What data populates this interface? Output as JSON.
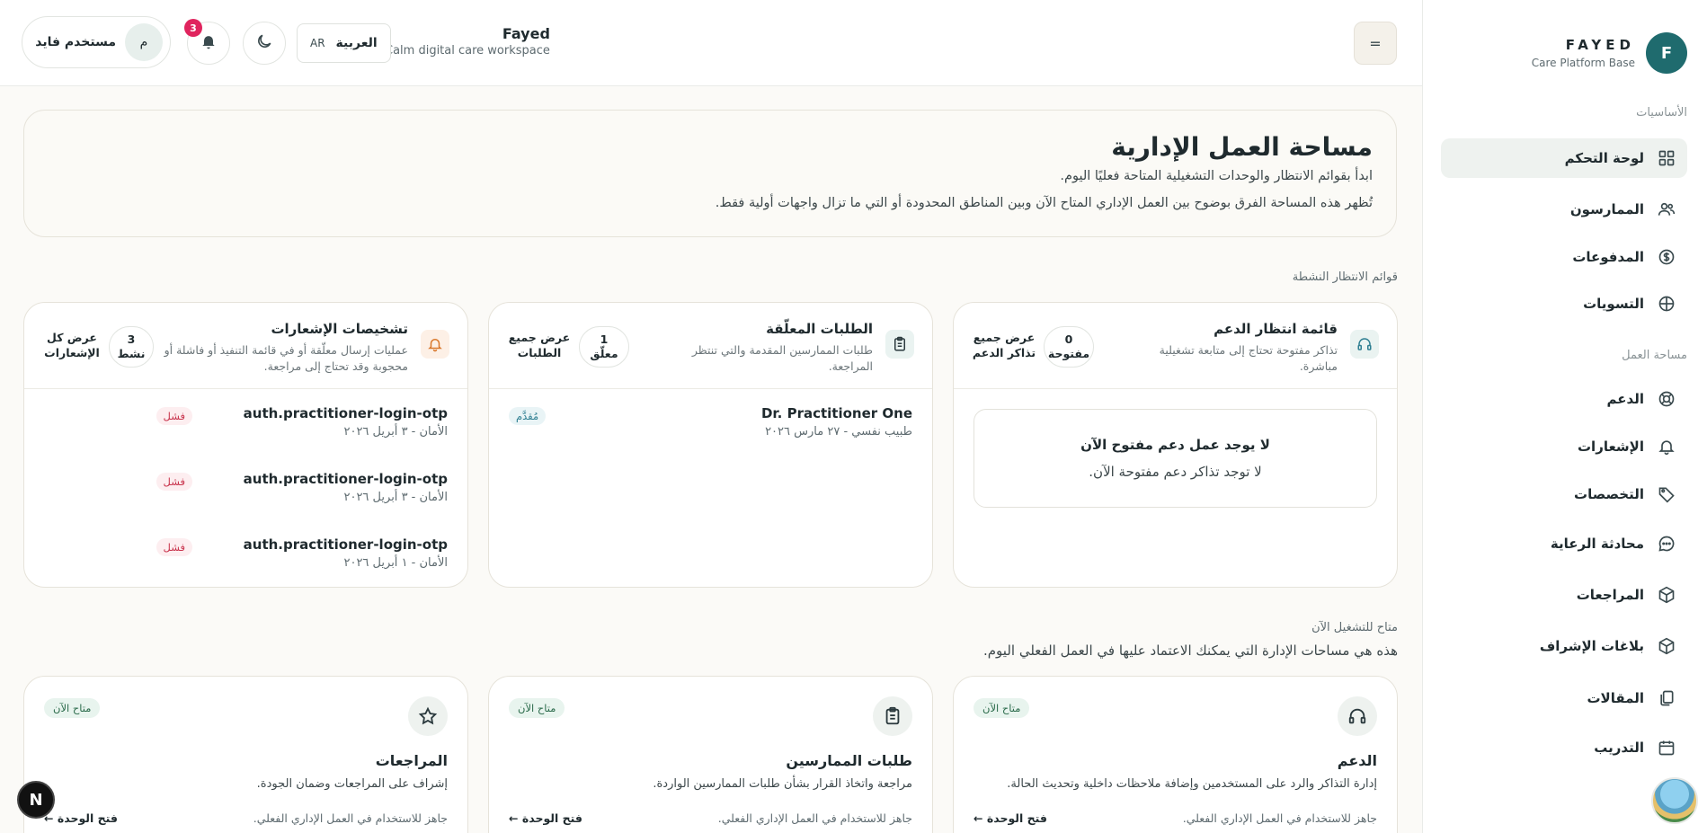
{
  "brand": {
    "name": "FAYED",
    "subtitle": "Care Platform Base",
    "initial": "F"
  },
  "sidebar": {
    "section_basics": "الأساسيات",
    "section_workspace": "مساحة العمل",
    "items": [
      {
        "label": "لوحة التحكم",
        "icon": "grid-icon",
        "active": true
      },
      {
        "label": "الممارسون",
        "icon": "users-icon"
      },
      {
        "label": "المدفوعات",
        "icon": "dollar-icon"
      },
      {
        "label": "التسويات",
        "icon": "globe-icon"
      },
      {
        "label": "الدعم",
        "icon": "lifebuoy-icon"
      },
      {
        "label": "الإشعارات",
        "icon": "bell-icon"
      },
      {
        "label": "التخصصات",
        "icon": "tag-icon"
      },
      {
        "label": "محادثة الرعاية",
        "icon": "chat-icon"
      },
      {
        "label": "المراجعات",
        "icon": "box-icon"
      },
      {
        "label": "بلاغات الإشراف",
        "icon": "box-icon"
      },
      {
        "label": "المقالات",
        "icon": "copy-icon"
      },
      {
        "label": "التدريب",
        "icon": "calendar-icon"
      }
    ]
  },
  "header": {
    "menu_label": "=",
    "workspace_name": "Fayed",
    "workspace_tagline": "Calm digital care workspace",
    "lang_code": "AR",
    "lang_name": "العربية",
    "notif_count": "3",
    "user_initial": "م",
    "user_name": "مستخدم فايد"
  },
  "hero": {
    "title": "مساحة العمل الإدارية",
    "line1": "ابدأ بقوائم الانتظار والوحدات التشغيلية المتاحة فعليًا اليوم.",
    "line2": "تُظهر هذه المساحة الفرق بوضوح بين العمل الإداري المتاح الآن وبين المناطق المحدودة أو التي ما تزال واجهات أولية فقط."
  },
  "queues_label": "قوائم الانتظار النشطة",
  "queues": {
    "support": {
      "title": "قائمة انتظار الدعم",
      "desc": "تذاكر مفتوحة تحتاج إلى متابعة تشغيلية مباشرة.",
      "count": "0",
      "count_label": "مفتوحة",
      "link": "عرض جميع تذاكر الدعم",
      "empty_title": "لا يوجد عمل دعم مفتوح الآن",
      "empty_desc": "لا توجد تذاكر دعم مفتوحة الآن."
    },
    "requests": {
      "title": "الطلبات المعلّقة",
      "desc": "طلبات الممارسين المقدمة والتي تنتظر المراجعة.",
      "count": "1",
      "count_label": "معلّق",
      "link": "عرض جميع الطلبات",
      "rows": [
        {
          "title": "Dr. Practitioner One",
          "sub": "طبيب نفسي - ٢٧ مارس ٢٠٢٦",
          "status": "مُقدَّم"
        }
      ]
    },
    "notifications": {
      "title": "تشخيصات الإشعارات",
      "desc": "عمليات إرسال معلّقة أو في قائمة التنفيذ أو فاشلة أو محجوبة وقد تحتاج إلى مراجعة.",
      "count": "3",
      "count_label": "نشط",
      "link": "عرض كل الإشعارات",
      "rows": [
        {
          "title": "auth.practitioner-login-otp",
          "sub": "الأمان - ٣ أبريل ٢٠٢٦",
          "status": "فشل"
        },
        {
          "title": "auth.practitioner-login-otp",
          "sub": "الأمان - ٣ أبريل ٢٠٢٦",
          "status": "فشل"
        },
        {
          "title": "auth.practitioner-login-otp",
          "sub": "الأمان - ١ أبريل ٢٠٢٦",
          "status": "فشل"
        }
      ]
    }
  },
  "available": {
    "label": "متاح للتشغيل الآن",
    "desc": "هذه هي مساحات الإدارة التي يمكنك الاعتماد عليها في العمل الفعلي اليوم.",
    "cards": [
      {
        "title": "الدعم",
        "desc": "إدارة التذاكر والرد على المستخدمين وإضافة ملاحظات داخلية وتحديث الحالة.",
        "status": "متاح الآن",
        "footer": "جاهز للاستخدام في العمل الإداري الفعلي.",
        "link": "فتح الوحدة",
        "icon": "headset-icon"
      },
      {
        "title": "طلبات الممارسين",
        "desc": "مراجعة واتخاذ القرار بشأن طلبات الممارسين الواردة.",
        "status": "متاح الآن",
        "footer": "جاهز للاستخدام في العمل الإداري الفعلي.",
        "link": "فتح الوحدة",
        "icon": "clipboard-icon"
      },
      {
        "title": "المراجعات",
        "desc": "إشراف على المراجعات وضمان الجودة.",
        "status": "متاح الآن",
        "footer": "جاهز للاستخدام في العمل الإداري الفعلي.",
        "link": "فتح الوحدة",
        "icon": "star-icon"
      }
    ]
  },
  "dev_badge": "N",
  "colors": {
    "accent": "#1f6b6e",
    "danger": "#e0245e",
    "success_bg": "#e8f4ee"
  }
}
